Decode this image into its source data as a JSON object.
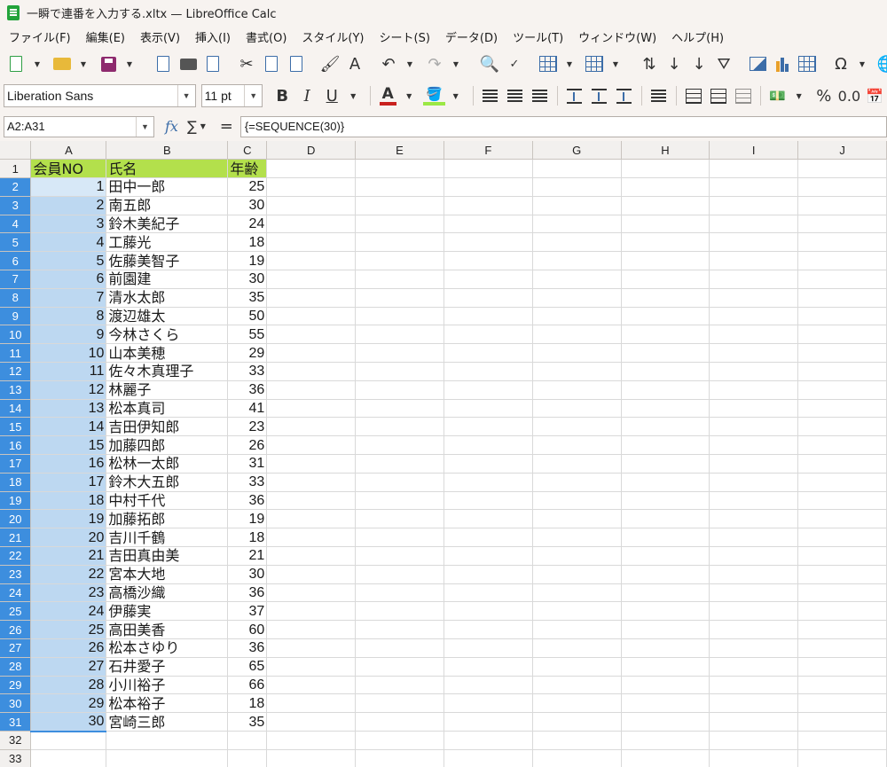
{
  "window": {
    "title": "一瞬で連番を入力する.xltx — LibreOffice Calc"
  },
  "menu": [
    "ファイル(F)",
    "編集(E)",
    "表示(V)",
    "挿入(I)",
    "書式(O)",
    "スタイル(Y)",
    "シート(S)",
    "データ(D)",
    "ツール(T)",
    "ウィンドウ(W)",
    "ヘルプ(H)"
  ],
  "format_toolbar": {
    "font_name": "Liberation Sans",
    "font_size": "11 pt",
    "percent_label": "%",
    "decimal_label": "0.0"
  },
  "formula_bar": {
    "name_box": "A2:A31",
    "formula": "{=SEQUENCE(30)}",
    "sum_symbol": "∑",
    "equals_symbol": "="
  },
  "sheet": {
    "columns": [
      "A",
      "B",
      "C",
      "D",
      "E",
      "F",
      "G",
      "H",
      "I",
      "J"
    ],
    "selected_column": "A",
    "headers": {
      "a": "会員NO",
      "b": "氏名",
      "c": "年齢"
    },
    "rows": [
      {
        "no": "1",
        "name": "田中一郎",
        "age": "25"
      },
      {
        "no": "2",
        "name": "南五郎",
        "age": "30"
      },
      {
        "no": "3",
        "name": "鈴木美紀子",
        "age": "24"
      },
      {
        "no": "4",
        "name": "工藤光",
        "age": "18"
      },
      {
        "no": "5",
        "name": "佐藤美智子",
        "age": "19"
      },
      {
        "no": "6",
        "name": "前園建",
        "age": "30"
      },
      {
        "no": "7",
        "name": "清水太郎",
        "age": "35"
      },
      {
        "no": "8",
        "name": "渡辺雄太",
        "age": "50"
      },
      {
        "no": "9",
        "name": "今林さくら",
        "age": "55"
      },
      {
        "no": "10",
        "name": "山本美穂",
        "age": "29"
      },
      {
        "no": "11",
        "name": "佐々木真理子",
        "age": "33"
      },
      {
        "no": "12",
        "name": "林麗子",
        "age": "36"
      },
      {
        "no": "13",
        "name": "松本真司",
        "age": "41"
      },
      {
        "no": "14",
        "name": "吉田伊知郎",
        "age": "23"
      },
      {
        "no": "15",
        "name": "加藤四郎",
        "age": "26"
      },
      {
        "no": "16",
        "name": "松林一太郎",
        "age": "31"
      },
      {
        "no": "17",
        "name": "鈴木大五郎",
        "age": "33"
      },
      {
        "no": "18",
        "name": "中村千代",
        "age": "36"
      },
      {
        "no": "19",
        "name": "加藤拓郎",
        "age": "19"
      },
      {
        "no": "20",
        "name": "吉川千鶴",
        "age": "18"
      },
      {
        "no": "21",
        "name": "吉田真由美",
        "age": "21"
      },
      {
        "no": "22",
        "name": "宮本大地",
        "age": "30"
      },
      {
        "no": "23",
        "name": "高橋沙織",
        "age": "36"
      },
      {
        "no": "24",
        "name": "伊藤実",
        "age": "37"
      },
      {
        "no": "25",
        "name": "高田美香",
        "age": "60"
      },
      {
        "no": "26",
        "name": "松本さゆり",
        "age": "36"
      },
      {
        "no": "27",
        "name": "石井愛子",
        "age": "65"
      },
      {
        "no": "28",
        "name": "小川裕子",
        "age": "66"
      },
      {
        "no": "29",
        "name": "松本裕子",
        "age": "18"
      },
      {
        "no": "30",
        "name": "宮崎三郎",
        "age": "35"
      }
    ],
    "empty_row_numbers": [
      "32",
      "33"
    ]
  },
  "colors": {
    "header_fill": "#b3e04c",
    "selection_fill": "#bdd8f1",
    "selected_header": "#3d8ede"
  }
}
